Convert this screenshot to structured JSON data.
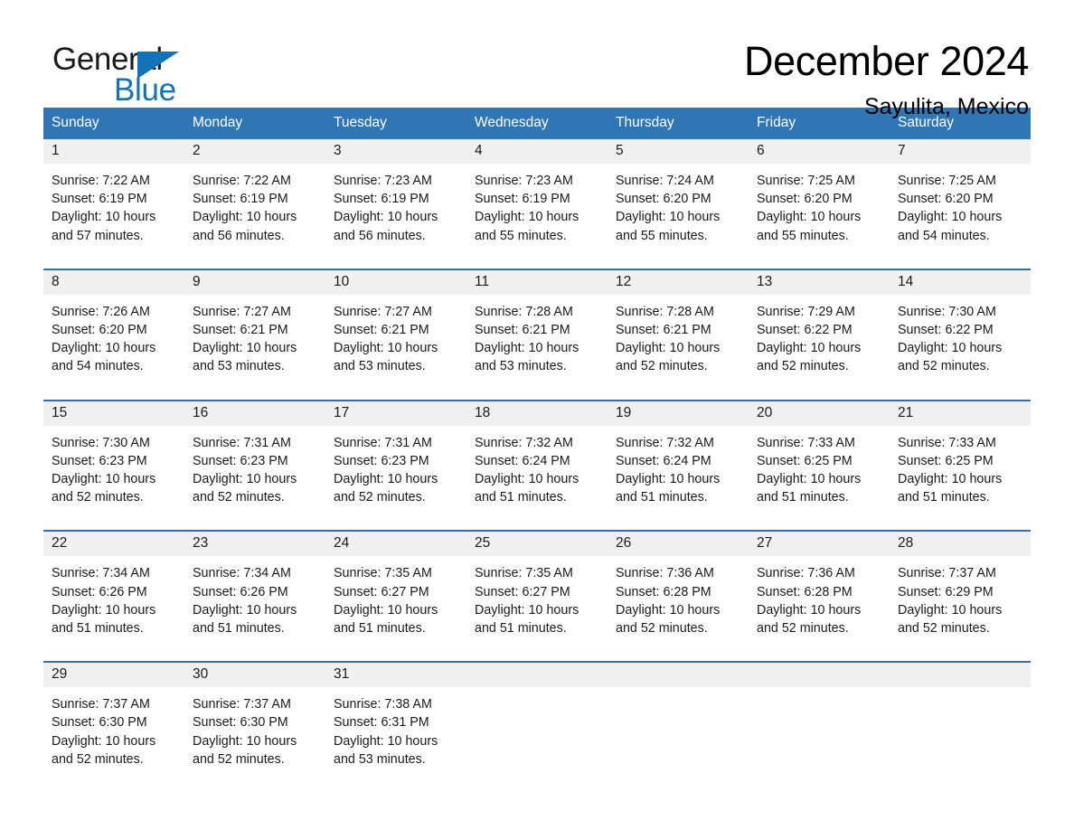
{
  "brand": {
    "name_top": "General",
    "name_bottom": "Blue",
    "accent_color": "#1373b9"
  },
  "header": {
    "month_title": "December 2024",
    "location": "Sayulita, Mexico"
  },
  "calendar": {
    "header_background": "#3075b4",
    "row_border_color": "#2f6fab",
    "daynum_background": "#f0f0f0",
    "weekdays": [
      "Sunday",
      "Monday",
      "Tuesday",
      "Wednesday",
      "Thursday",
      "Friday",
      "Saturday"
    ],
    "weeks": [
      [
        {
          "day": "1",
          "sunrise": "Sunrise: 7:22 AM",
          "sunset": "Sunset: 6:19 PM",
          "daylight_line1": "Daylight: 10 hours",
          "daylight_line2": "and 57 minutes."
        },
        {
          "day": "2",
          "sunrise": "Sunrise: 7:22 AM",
          "sunset": "Sunset: 6:19 PM",
          "daylight_line1": "Daylight: 10 hours",
          "daylight_line2": "and 56 minutes."
        },
        {
          "day": "3",
          "sunrise": "Sunrise: 7:23 AM",
          "sunset": "Sunset: 6:19 PM",
          "daylight_line1": "Daylight: 10 hours",
          "daylight_line2": "and 56 minutes."
        },
        {
          "day": "4",
          "sunrise": "Sunrise: 7:23 AM",
          "sunset": "Sunset: 6:19 PM",
          "daylight_line1": "Daylight: 10 hours",
          "daylight_line2": "and 55 minutes."
        },
        {
          "day": "5",
          "sunrise": "Sunrise: 7:24 AM",
          "sunset": "Sunset: 6:20 PM",
          "daylight_line1": "Daylight: 10 hours",
          "daylight_line2": "and 55 minutes."
        },
        {
          "day": "6",
          "sunrise": "Sunrise: 7:25 AM",
          "sunset": "Sunset: 6:20 PM",
          "daylight_line1": "Daylight: 10 hours",
          "daylight_line2": "and 55 minutes."
        },
        {
          "day": "7",
          "sunrise": "Sunrise: 7:25 AM",
          "sunset": "Sunset: 6:20 PM",
          "daylight_line1": "Daylight: 10 hours",
          "daylight_line2": "and 54 minutes."
        }
      ],
      [
        {
          "day": "8",
          "sunrise": "Sunrise: 7:26 AM",
          "sunset": "Sunset: 6:20 PM",
          "daylight_line1": "Daylight: 10 hours",
          "daylight_line2": "and 54 minutes."
        },
        {
          "day": "9",
          "sunrise": "Sunrise: 7:27 AM",
          "sunset": "Sunset: 6:21 PM",
          "daylight_line1": "Daylight: 10 hours",
          "daylight_line2": "and 53 minutes."
        },
        {
          "day": "10",
          "sunrise": "Sunrise: 7:27 AM",
          "sunset": "Sunset: 6:21 PM",
          "daylight_line1": "Daylight: 10 hours",
          "daylight_line2": "and 53 minutes."
        },
        {
          "day": "11",
          "sunrise": "Sunrise: 7:28 AM",
          "sunset": "Sunset: 6:21 PM",
          "daylight_line1": "Daylight: 10 hours",
          "daylight_line2": "and 53 minutes."
        },
        {
          "day": "12",
          "sunrise": "Sunrise: 7:28 AM",
          "sunset": "Sunset: 6:21 PM",
          "daylight_line1": "Daylight: 10 hours",
          "daylight_line2": "and 52 minutes."
        },
        {
          "day": "13",
          "sunrise": "Sunrise: 7:29 AM",
          "sunset": "Sunset: 6:22 PM",
          "daylight_line1": "Daylight: 10 hours",
          "daylight_line2": "and 52 minutes."
        },
        {
          "day": "14",
          "sunrise": "Sunrise: 7:30 AM",
          "sunset": "Sunset: 6:22 PM",
          "daylight_line1": "Daylight: 10 hours",
          "daylight_line2": "and 52 minutes."
        }
      ],
      [
        {
          "day": "15",
          "sunrise": "Sunrise: 7:30 AM",
          "sunset": "Sunset: 6:23 PM",
          "daylight_line1": "Daylight: 10 hours",
          "daylight_line2": "and 52 minutes."
        },
        {
          "day": "16",
          "sunrise": "Sunrise: 7:31 AM",
          "sunset": "Sunset: 6:23 PM",
          "daylight_line1": "Daylight: 10 hours",
          "daylight_line2": "and 52 minutes."
        },
        {
          "day": "17",
          "sunrise": "Sunrise: 7:31 AM",
          "sunset": "Sunset: 6:23 PM",
          "daylight_line1": "Daylight: 10 hours",
          "daylight_line2": "and 52 minutes."
        },
        {
          "day": "18",
          "sunrise": "Sunrise: 7:32 AM",
          "sunset": "Sunset: 6:24 PM",
          "daylight_line1": "Daylight: 10 hours",
          "daylight_line2": "and 51 minutes."
        },
        {
          "day": "19",
          "sunrise": "Sunrise: 7:32 AM",
          "sunset": "Sunset: 6:24 PM",
          "daylight_line1": "Daylight: 10 hours",
          "daylight_line2": "and 51 minutes."
        },
        {
          "day": "20",
          "sunrise": "Sunrise: 7:33 AM",
          "sunset": "Sunset: 6:25 PM",
          "daylight_line1": "Daylight: 10 hours",
          "daylight_line2": "and 51 minutes."
        },
        {
          "day": "21",
          "sunrise": "Sunrise: 7:33 AM",
          "sunset": "Sunset: 6:25 PM",
          "daylight_line1": "Daylight: 10 hours",
          "daylight_line2": "and 51 minutes."
        }
      ],
      [
        {
          "day": "22",
          "sunrise": "Sunrise: 7:34 AM",
          "sunset": "Sunset: 6:26 PM",
          "daylight_line1": "Daylight: 10 hours",
          "daylight_line2": "and 51 minutes."
        },
        {
          "day": "23",
          "sunrise": "Sunrise: 7:34 AM",
          "sunset": "Sunset: 6:26 PM",
          "daylight_line1": "Daylight: 10 hours",
          "daylight_line2": "and 51 minutes."
        },
        {
          "day": "24",
          "sunrise": "Sunrise: 7:35 AM",
          "sunset": "Sunset: 6:27 PM",
          "daylight_line1": "Daylight: 10 hours",
          "daylight_line2": "and 51 minutes."
        },
        {
          "day": "25",
          "sunrise": "Sunrise: 7:35 AM",
          "sunset": "Sunset: 6:27 PM",
          "daylight_line1": "Daylight: 10 hours",
          "daylight_line2": "and 51 minutes."
        },
        {
          "day": "26",
          "sunrise": "Sunrise: 7:36 AM",
          "sunset": "Sunset: 6:28 PM",
          "daylight_line1": "Daylight: 10 hours",
          "daylight_line2": "and 52 minutes."
        },
        {
          "day": "27",
          "sunrise": "Sunrise: 7:36 AM",
          "sunset": "Sunset: 6:28 PM",
          "daylight_line1": "Daylight: 10 hours",
          "daylight_line2": "and 52 minutes."
        },
        {
          "day": "28",
          "sunrise": "Sunrise: 7:37 AM",
          "sunset": "Sunset: 6:29 PM",
          "daylight_line1": "Daylight: 10 hours",
          "daylight_line2": "and 52 minutes."
        }
      ],
      [
        {
          "day": "29",
          "sunrise": "Sunrise: 7:37 AM",
          "sunset": "Sunset: 6:30 PM",
          "daylight_line1": "Daylight: 10 hours",
          "daylight_line2": "and 52 minutes."
        },
        {
          "day": "30",
          "sunrise": "Sunrise: 7:37 AM",
          "sunset": "Sunset: 6:30 PM",
          "daylight_line1": "Daylight: 10 hours",
          "daylight_line2": "and 52 minutes."
        },
        {
          "day": "31",
          "sunrise": "Sunrise: 7:38 AM",
          "sunset": "Sunset: 6:31 PM",
          "daylight_line1": "Daylight: 10 hours",
          "daylight_line2": "and 53 minutes."
        },
        {
          "day": "",
          "sunrise": "",
          "sunset": "",
          "daylight_line1": "",
          "daylight_line2": ""
        },
        {
          "day": "",
          "sunrise": "",
          "sunset": "",
          "daylight_line1": "",
          "daylight_line2": ""
        },
        {
          "day": "",
          "sunrise": "",
          "sunset": "",
          "daylight_line1": "",
          "daylight_line2": ""
        },
        {
          "day": "",
          "sunrise": "",
          "sunset": "",
          "daylight_line1": "",
          "daylight_line2": ""
        }
      ]
    ]
  }
}
